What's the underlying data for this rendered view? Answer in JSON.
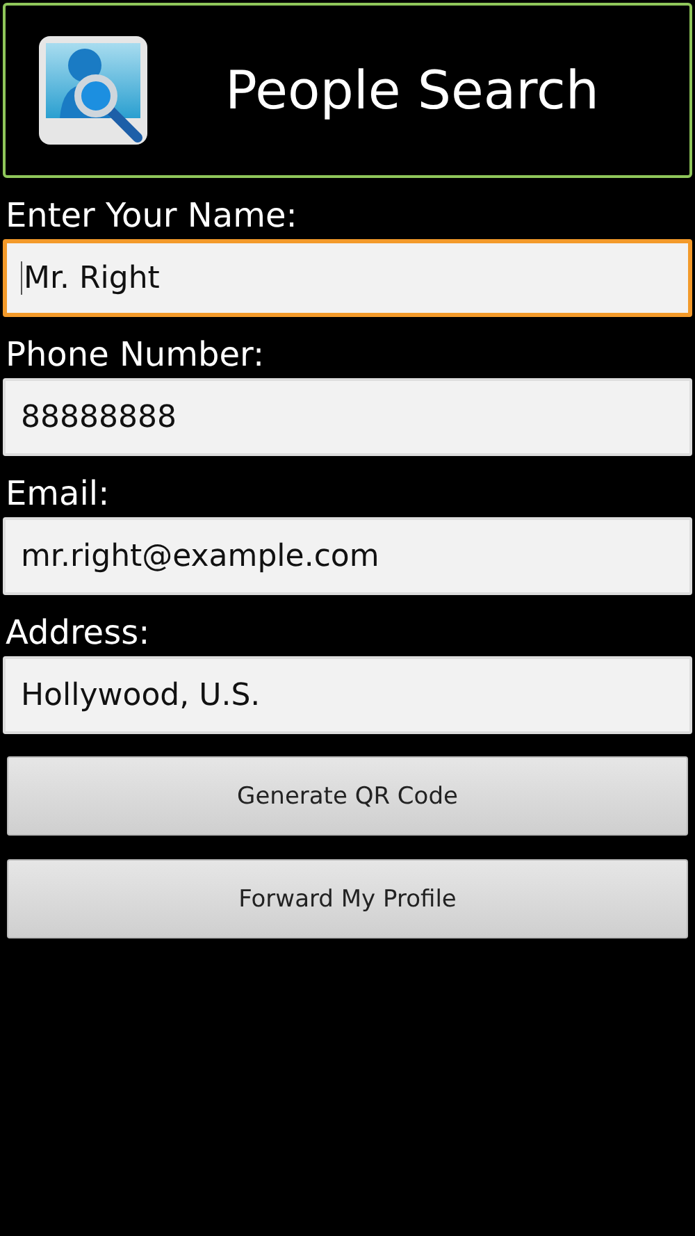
{
  "header": {
    "title": "People Search"
  },
  "fields": [
    {
      "label": "Enter Your Name:",
      "value": "Mr. Right",
      "focused": true
    },
    {
      "label": "Phone Number:",
      "value": "88888888",
      "focused": false
    },
    {
      "label": "Email:",
      "value": "mr.right@example.com",
      "focused": false
    },
    {
      "label": "Address:",
      "value": "Hollywood, U.S.",
      "focused": false
    }
  ],
  "buttons": [
    "Generate QR Code",
    "Forward My Profile"
  ]
}
